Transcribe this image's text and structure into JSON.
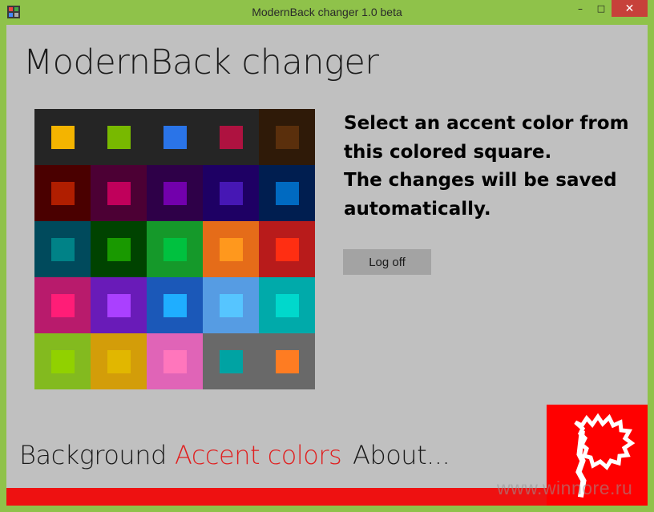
{
  "window": {
    "title": "ModernBack changer 1.0 beta",
    "minimize_glyph": "–",
    "maximize_glyph": "□",
    "close_glyph": "✕"
  },
  "app_title": "ModernBack changer",
  "instructions": [
    "Select an accent color from",
    "this colored square.",
    "The changes will be saved",
    "automatically."
  ],
  "logoff_label": "Log off",
  "nav": {
    "background": "Background",
    "accent_colors": "Accent colors",
    "about": "About..."
  },
  "watermark": "www.winnore.ru",
  "colors": {
    "active_nav": "#e02020",
    "bottom_bar": "#ee1111",
    "logo_tile": "#ff0000",
    "client_bg": "#c0c0c0",
    "frame": "#8fc24a"
  },
  "accent_grid": [
    [
      {
        "bg": "#252525",
        "swatch": "#f4b400"
      },
      {
        "bg": "#252525",
        "swatch": "#78b900"
      },
      {
        "bg": "#252525",
        "swatch": "#2a74e8"
      },
      {
        "bg": "#252525",
        "swatch": "#ae1240"
      },
      {
        "bg": "#2f1a08",
        "swatch": "#5a2f0c"
      }
    ],
    [
      {
        "bg": "#4a0000",
        "swatch": "#b01e00"
      },
      {
        "bg": "#4c0034",
        "swatch": "#c0005b"
      },
      {
        "bg": "#2e0048",
        "swatch": "#7200ac"
      },
      {
        "bg": "#1e0064",
        "swatch": "#4617b4"
      },
      {
        "bg": "#001e50",
        "swatch": "#006ac1"
      }
    ],
    [
      {
        "bg": "#004a5c",
        "swatch": "#008287"
      },
      {
        "bg": "#004300",
        "swatch": "#199900"
      },
      {
        "bg": "#15992a",
        "swatch": "#00c13f"
      },
      {
        "bg": "#e56c19",
        "swatch": "#ff981d"
      },
      {
        "bg": "#b81b1b",
        "swatch": "#ff2e12"
      }
    ],
    [
      {
        "bg": "#b81b6c",
        "swatch": "#ff1d77"
      },
      {
        "bg": "#691bb8",
        "swatch": "#aa40ff"
      },
      {
        "bg": "#1b58b8",
        "swatch": "#1faeff"
      },
      {
        "bg": "#569ce3",
        "swatch": "#56c5ff"
      },
      {
        "bg": "#00aaaa",
        "swatch": "#00d8cc"
      }
    ],
    [
      {
        "bg": "#83ba1f",
        "swatch": "#91d100"
      },
      {
        "bg": "#d39d09",
        "swatch": "#e1b700"
      },
      {
        "bg": "#e064b7",
        "swatch": "#ff76bc"
      },
      {
        "bg": "#696969",
        "swatch": "#00a3a3"
      },
      {
        "bg": "#696969",
        "swatch": "#fe7c22"
      }
    ]
  ]
}
